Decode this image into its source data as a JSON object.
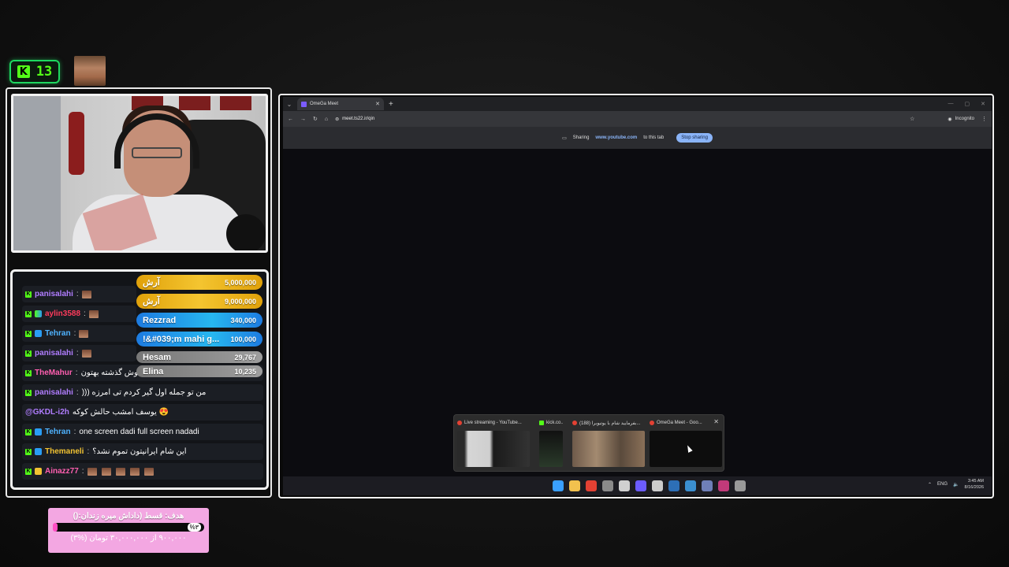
{
  "kick_badge": {
    "count": "13",
    "icon": "kick-logo-icon",
    "color": "#53fc18"
  },
  "chat": {
    "rows": [
      {
        "user": "panisalahi",
        "color": "#b07dff",
        "badges": [
          "kick"
        ],
        "message": "",
        "emotes": 1
      },
      {
        "user": "aylin3588",
        "color": "#ff3b5c",
        "badges": [
          "kick",
          "multi"
        ],
        "message": "",
        "emotes": 1
      },
      {
        "user": "Tehran",
        "color": "#4fb3ff",
        "badges": [
          "kick",
          "blue"
        ],
        "message": "",
        "emotes": 1
      },
      {
        "user": "panisalahi",
        "color": "#b07dff",
        "badges": [
          "kick"
        ],
        "message": "",
        "emotes": 1
      },
      {
        "user": "TheMahur",
        "color": "#ff5fb0",
        "badges": [
          "kick"
        ],
        "message": "شما واقعا خوش گذشته بهتون",
        "emotes": 0
      },
      {
        "user": "panisalahi",
        "color": "#b07dff",
        "badges": [
          "kick"
        ],
        "message": "))) من تو جمله اول گیر کردم تی امرزه",
        "emotes": 0
      },
      {
        "user": "@GKDL-i2h",
        "color": "#b07dff",
        "badges": [],
        "message": "یوسف امشب حالش کوکه 😍",
        "emotes": 0
      },
      {
        "user": "Tehran",
        "color": "#4fb3ff",
        "badges": [
          "kick",
          "blue"
        ],
        "message": "one screen dadi full screen nadadi",
        "emotes": 0
      },
      {
        "user": "Themaneli",
        "color": "#f1c232",
        "badges": [
          "kick",
          "blue"
        ],
        "message": "این شام ایرانیتون تموم نشد؟",
        "emotes": 0
      },
      {
        "user": "Ainazz77",
        "color": "#ff5fb0",
        "badges": [
          "kick",
          "gold"
        ],
        "message": "",
        "emotes": 5
      }
    ]
  },
  "donors": [
    {
      "name": "آرش",
      "amount": "5,000,000",
      "style": "gold"
    },
    {
      "name": "آرش",
      "amount": "9,000,000",
      "style": "gold"
    },
    {
      "name": "Rezzrad",
      "amount": "340,000",
      "style": "blue"
    },
    {
      "name": "!&#039;m mahi g...",
      "amount": "100,000",
      "style": "blue"
    },
    {
      "name": "Hesam",
      "amount": "29,767",
      "style": "grey"
    },
    {
      "name": "Elina",
      "amount": "10,235",
      "style": "grey"
    }
  ],
  "goal": {
    "title": "هدف: قسط (داداش میره زندان:()",
    "percent_label": "%۳",
    "progress": 0.03,
    "subtitle": "۹۰۰,۰۰۰ از ۳۰,۰۰۰,۰۰۰ تومان (%۳)"
  },
  "browser": {
    "tab_title": "OmeGa Meet",
    "url": "meet.ts22.ir/qin",
    "incognito_label": "Incognito",
    "share_text_1": "Sharing",
    "share_link": "www.youtube.com",
    "share_text_2": "to this tab",
    "stop_sharing": "Stop sharing"
  },
  "thumbnails": [
    {
      "title": "Live streaming - YouTube...",
      "icon": "chrome-icon"
    },
    {
      "title": "kick.co...",
      "icon": "kick-icon"
    },
    {
      "title": "(188) بفرمایید شام با یوتیوبرا...",
      "icon": "chrome-icon"
    },
    {
      "title": "OmeGa Meet - Goo...",
      "icon": "chrome-icon"
    }
  ],
  "taskbar": {
    "lang": "ENG",
    "time": "3:45 AM",
    "date": "8/16/2026"
  }
}
